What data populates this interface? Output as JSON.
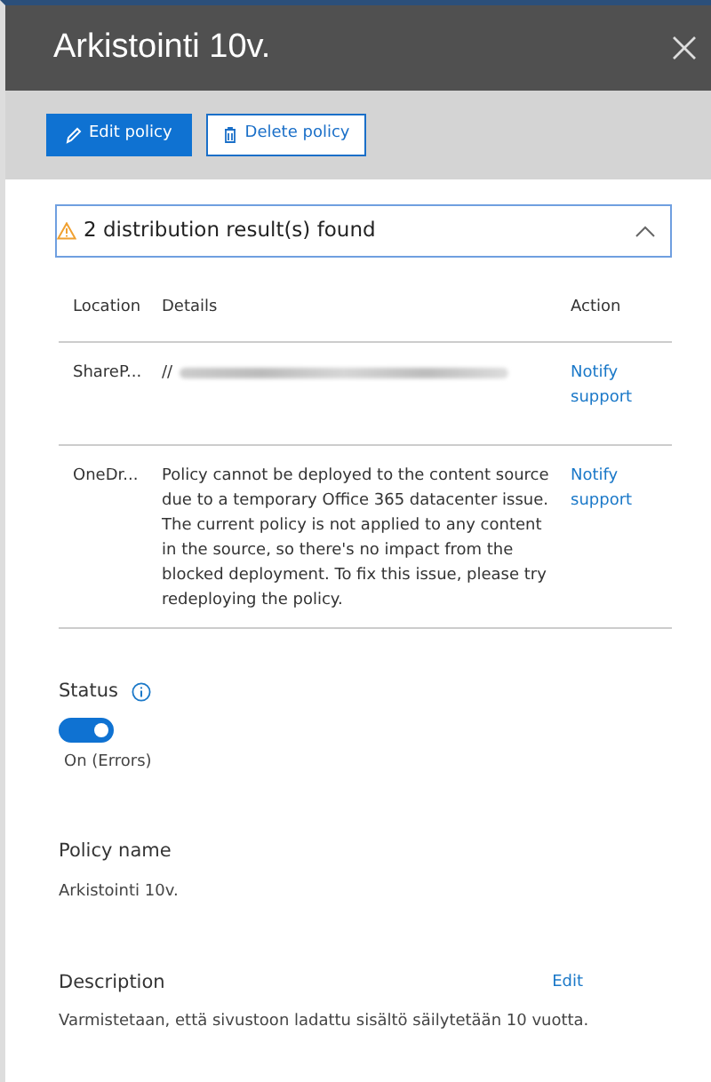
{
  "panel": {
    "title": "Arkistointi 10v."
  },
  "toolbar": {
    "buttons": [
      {
        "label": "Edit policy",
        "kind": "primary"
      },
      {
        "label": "Delete policy",
        "kind": "secondary"
      }
    ]
  },
  "results": {
    "summary": "2 distribution result(s) found",
    "expanded": true,
    "columns": [
      "Location",
      "Details",
      "Action"
    ],
    "rows": [
      {
        "location": "ShareP...",
        "details": "//",
        "redacted": true,
        "action": "Notify support"
      },
      {
        "location": "OneDr...",
        "details": "Policy cannot be deployed to the content source due to a temporary Office 365 datacenter issue. The current policy is not applied to any content in the source, so there's no impact from the blocked deployment. To fix this issue, please try redeploying the policy.",
        "redacted": false,
        "action": "Notify support"
      }
    ]
  },
  "status": {
    "label": "Status",
    "on": true,
    "value": "On (Errors)"
  },
  "fields": [
    {
      "label": "Policy name",
      "value": "Arkistointi 10v."
    },
    {
      "label": "Description",
      "value": "Varmistetaan, että sivustoon ladattu sisältö säilytetään 10 vuotta.",
      "action": "Edit"
    }
  ]
}
